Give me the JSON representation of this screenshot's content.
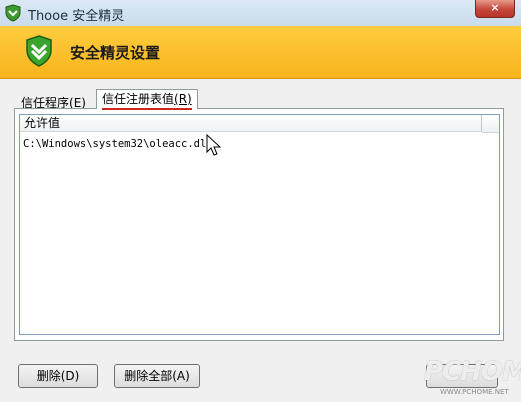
{
  "window": {
    "title": "Thooe 安全精灵",
    "close_label": "×"
  },
  "banner": {
    "title": "安全精灵设置"
  },
  "tabs": [
    {
      "label": "信任程序",
      "shortcut": "(E)",
      "active": false
    },
    {
      "label": "信任注册表值",
      "shortcut": "(R)",
      "active": true
    }
  ],
  "list": {
    "column_header": "允许值",
    "rows": [
      "C:\\Windows\\system32\\oleacc.dll"
    ]
  },
  "buttons": {
    "delete": "删除(D)",
    "delete_all": "删除全部(A)"
  },
  "watermark": {
    "main": "PCHOME",
    "sub": "WWW.PCHOME.NET"
  },
  "colors": {
    "banner": "#f7b41c",
    "annotation_red": "#d0271e"
  }
}
